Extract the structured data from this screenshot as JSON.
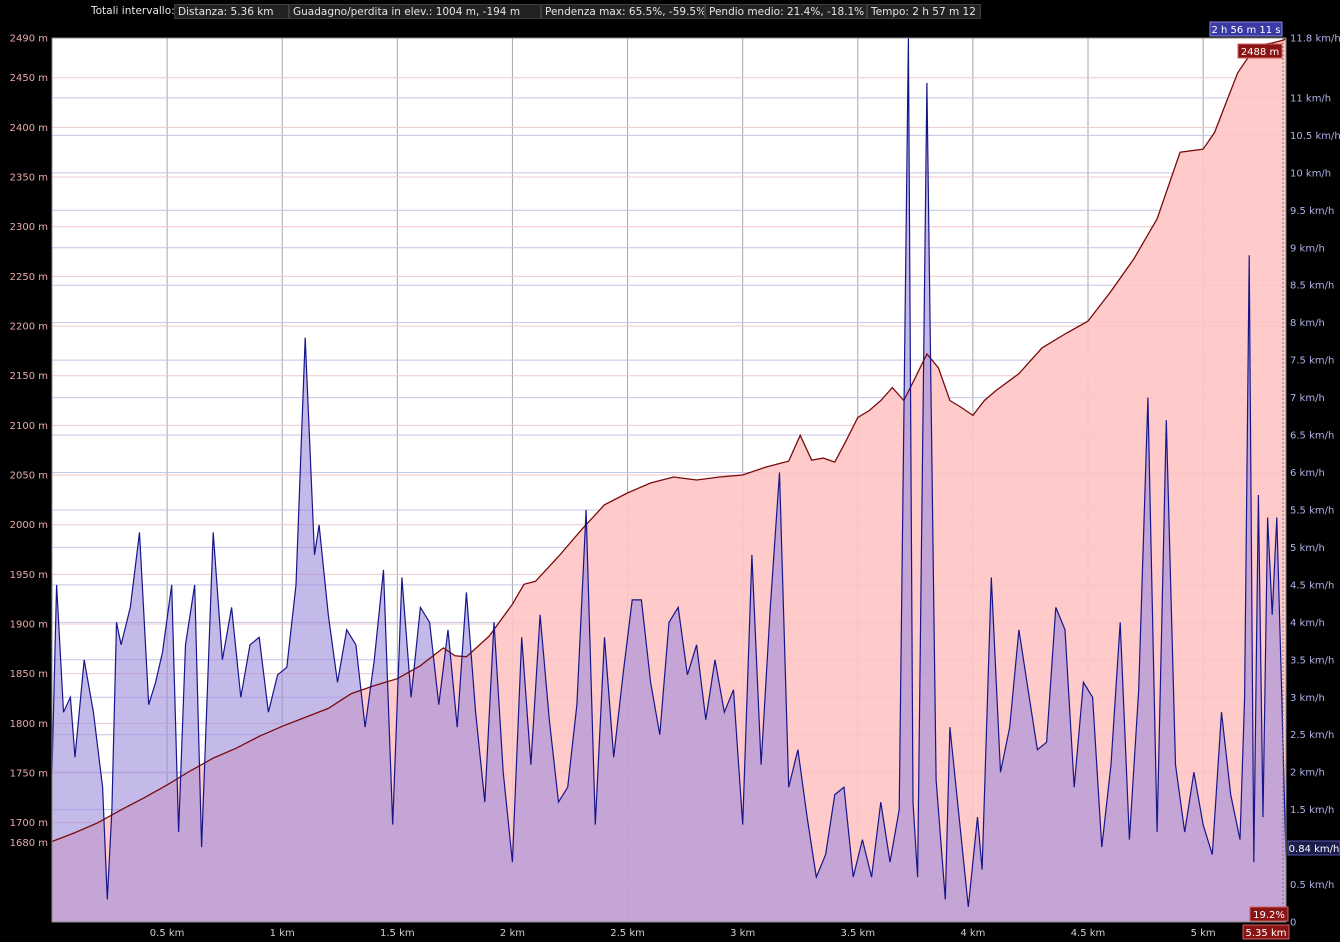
{
  "summary": {
    "label": "Totali intervallo:",
    "distance": "Distanza: 5.36 km",
    "gain_loss": "Guadagno/perdita in elev.: 1004 m, -194 m",
    "max_slope": "Pendenza max: 65.5%, -59.5%",
    "avg_slope": "Pendio medio: 21.4%, -18.1%",
    "time": "Tempo: 2 h 57 m 12 s"
  },
  "markers": {
    "time_readout": "2 h 56 m 11 s",
    "elevation_readout": "2488 m",
    "speed_readout": "0.84 km/h",
    "slope_readout": "19.2%",
    "distance_readout": "5.35 km"
  },
  "colors": {
    "elevation_line": "#7a0a0a",
    "elevation_fill": "#ffc4c4",
    "speed_line": "#16168a",
    "speed_fill": "#9c8cdc",
    "elevation_badge": "#8a1414",
    "speed_badge": "#3a3aa6"
  },
  "chart_data": {
    "type": "area",
    "x_range": [
      0,
      5.36
    ],
    "x_unit": "km",
    "x_ticks": [
      "0.5 km",
      "1 km",
      "1.5 km",
      "2 km",
      "2.5 km",
      "3 km",
      "3.5 km",
      "4 km",
      "4.5 km",
      "5 km"
    ],
    "left_axis": {
      "range": [
        1600,
        2490
      ],
      "ticks": [
        {
          "value": 2490,
          "label": "2490 m"
        },
        {
          "value": 2450,
          "label": "2450 m"
        },
        {
          "value": 2400,
          "label": "2400 m"
        },
        {
          "value": 2350,
          "label": "2350 m"
        },
        {
          "value": 2300,
          "label": "2300 m"
        },
        {
          "value": 2250,
          "label": "2250 m"
        },
        {
          "value": 2200,
          "label": "2200 m"
        },
        {
          "value": 2150,
          "label": "2150 m"
        },
        {
          "value": 2100,
          "label": "2100 m"
        },
        {
          "value": 2050,
          "label": "2050 m"
        },
        {
          "value": 2000,
          "label": "2000 m"
        },
        {
          "value": 1950,
          "label": "1950 m"
        },
        {
          "value": 1900,
          "label": "1900 m"
        },
        {
          "value": 1850,
          "label": "1850 m"
        },
        {
          "value": 1800,
          "label": "1800 m"
        },
        {
          "value": 1750,
          "label": "1750 m"
        },
        {
          "value": 1700,
          "label": "1700 m"
        },
        {
          "value": 1680,
          "label": "1680 m"
        }
      ]
    },
    "right_axis": {
      "range": [
        0,
        11.8
      ],
      "ticks": [
        {
          "value": 11.8,
          "label": "11.8 km/h"
        },
        {
          "value": 11,
          "label": "11 km/h"
        },
        {
          "value": 10.5,
          "label": "10.5 km/h"
        },
        {
          "value": 10,
          "label": "10 km/h"
        },
        {
          "value": 9.5,
          "label": "9.5 km/h"
        },
        {
          "value": 9,
          "label": "9 km/h"
        },
        {
          "value": 8.5,
          "label": "8.5 km/h"
        },
        {
          "value": 8,
          "label": "8 km/h"
        },
        {
          "value": 7.5,
          "label": "7.5 km/h"
        },
        {
          "value": 7,
          "label": "7 km/h"
        },
        {
          "value": 6.5,
          "label": "6.5 km/h"
        },
        {
          "value": 6,
          "label": "6 km/h"
        },
        {
          "value": 5.5,
          "label": "5.5 km/h"
        },
        {
          "value": 5,
          "label": "5 km/h"
        },
        {
          "value": 4.5,
          "label": "4.5 km/h"
        },
        {
          "value": 4,
          "label": "4 km/h"
        },
        {
          "value": 3.5,
          "label": "3.5 km/h"
        },
        {
          "value": 3,
          "label": "3 km/h"
        },
        {
          "value": 2.5,
          "label": "2.5 km/h"
        },
        {
          "value": 2,
          "label": "2 km/h"
        },
        {
          "value": 1.5,
          "label": "1.5 km/h"
        },
        {
          "value": 1,
          "label": "1 km/h"
        },
        {
          "value": 0.5,
          "label": "0.5 km/h"
        },
        {
          "value": 0,
          "label": "0"
        }
      ]
    },
    "series": [
      {
        "axis": "left",
        "x": [
          0,
          0.1,
          0.2,
          0.3,
          0.4,
          0.5,
          0.6,
          0.7,
          0.8,
          0.9,
          1.0,
          1.1,
          1.2,
          1.3,
          1.4,
          1.5,
          1.6,
          1.7,
          1.75,
          1.8,
          1.9,
          2.0,
          2.05,
          2.1,
          2.2,
          2.3,
          2.4,
          2.5,
          2.6,
          2.7,
          2.8,
          2.9,
          3.0,
          3.1,
          3.2,
          3.25,
          3.3,
          3.35,
          3.4,
          3.45,
          3.5,
          3.55,
          3.6,
          3.65,
          3.7,
          3.75,
          3.8,
          3.85,
          3.9,
          3.95,
          4.0,
          4.05,
          4.1,
          4.2,
          4.3,
          4.4,
          4.5,
          4.6,
          4.7,
          4.8,
          4.9,
          5.0,
          5.05,
          5.1,
          5.15,
          5.2,
          5.25,
          5.3,
          5.35,
          5.36
        ],
        "values": [
          1681,
          1690,
          1700,
          1713,
          1725,
          1738,
          1752,
          1765,
          1775,
          1787,
          1797,
          1806,
          1815,
          1830,
          1838,
          1845,
          1858,
          1876,
          1868,
          1867,
          1888,
          1920,
          1940,
          1943,
          1968,
          1995,
          2020,
          2032,
          2042,
          2048,
          2045,
          2048,
          2050,
          2058,
          2064,
          2090,
          2065,
          2067,
          2063,
          2085,
          2108,
          2115,
          2125,
          2138,
          2125,
          2148,
          2172,
          2158,
          2125,
          2118,
          2110,
          2125,
          2135,
          2152,
          2178,
          2192,
          2205,
          2235,
          2268,
          2308,
          2375,
          2378,
          2395,
          2425,
          2455,
          2472,
          2483,
          2485,
          2488,
          2490
        ]
      },
      {
        "axis": "right",
        "x": [
          0,
          0.02,
          0.05,
          0.08,
          0.1,
          0.14,
          0.18,
          0.22,
          0.24,
          0.26,
          0.28,
          0.3,
          0.34,
          0.38,
          0.42,
          0.45,
          0.48,
          0.52,
          0.55,
          0.58,
          0.62,
          0.65,
          0.7,
          0.74,
          0.78,
          0.82,
          0.86,
          0.9,
          0.94,
          0.98,
          1.02,
          1.06,
          1.1,
          1.14,
          1.16,
          1.2,
          1.24,
          1.28,
          1.32,
          1.36,
          1.4,
          1.44,
          1.48,
          1.52,
          1.56,
          1.6,
          1.64,
          1.68,
          1.72,
          1.76,
          1.8,
          1.84,
          1.88,
          1.92,
          1.96,
          2.0,
          2.04,
          2.08,
          2.12,
          2.16,
          2.2,
          2.24,
          2.28,
          2.32,
          2.36,
          2.4,
          2.44,
          2.48,
          2.52,
          2.56,
          2.6,
          2.64,
          2.68,
          2.72,
          2.76,
          2.8,
          2.84,
          2.88,
          2.92,
          2.96,
          3.0,
          3.04,
          3.08,
          3.12,
          3.16,
          3.2,
          3.24,
          3.28,
          3.32,
          3.36,
          3.4,
          3.44,
          3.48,
          3.52,
          3.56,
          3.6,
          3.64,
          3.68,
          3.72,
          3.74,
          3.76,
          3.8,
          3.84,
          3.88,
          3.9,
          3.94,
          3.98,
          4.02,
          4.04,
          4.08,
          4.12,
          4.16,
          4.2,
          4.24,
          4.28,
          4.32,
          4.36,
          4.4,
          4.44,
          4.48,
          4.52,
          4.56,
          4.6,
          4.64,
          4.68,
          4.72,
          4.76,
          4.8,
          4.84,
          4.88,
          4.92,
          4.96,
          5.0,
          5.04,
          5.08,
          5.12,
          5.16,
          5.18,
          5.2,
          5.22,
          5.24,
          5.26,
          5.28,
          5.3,
          5.32,
          5.34,
          5.36
        ],
        "values": [
          2.0,
          4.5,
          2.8,
          3.0,
          2.2,
          3.5,
          2.8,
          1.8,
          0.3,
          1.5,
          4.0,
          3.7,
          4.2,
          5.2,
          2.9,
          3.2,
          3.6,
          4.5,
          1.2,
          3.7,
          4.5,
          1.0,
          5.2,
          3.5,
          4.2,
          3.0,
          3.7,
          3.8,
          2.8,
          3.3,
          3.4,
          4.5,
          7.8,
          4.9,
          5.3,
          4.1,
          3.2,
          3.9,
          3.7,
          2.6,
          3.5,
          4.7,
          1.3,
          4.6,
          3.0,
          4.2,
          4.0,
          2.9,
          3.9,
          2.6,
          4.4,
          2.8,
          1.6,
          4.0,
          2.0,
          0.8,
          3.8,
          2.1,
          4.1,
          2.7,
          1.6,
          1.8,
          2.9,
          5.5,
          1.3,
          3.8,
          2.2,
          3.3,
          4.3,
          4.3,
          3.2,
          2.5,
          4.0,
          4.2,
          3.3,
          3.7,
          2.7,
          3.5,
          2.8,
          3.1,
          1.3,
          4.9,
          2.1,
          4.2,
          6.0,
          1.8,
          2.3,
          1.4,
          0.6,
          0.9,
          1.7,
          1.8,
          0.6,
          1.1,
          0.6,
          1.6,
          0.8,
          1.5,
          11.8,
          1.6,
          0.6,
          11.2,
          1.9,
          0.3,
          2.6,
          1.4,
          0.2,
          1.4,
          0.7,
          4.6,
          2.0,
          2.6,
          3.9,
          3.1,
          2.3,
          2.4,
          4.2,
          3.9,
          1.8,
          3.2,
          3.0,
          1.0,
          2.1,
          4.0,
          1.1,
          3.1,
          7.0,
          1.2,
          6.7,
          2.1,
          1.2,
          2.0,
          1.3,
          0.9,
          2.8,
          1.7,
          1.1,
          3.0,
          8.9,
          0.8,
          5.7,
          1.4,
          5.4,
          4.1,
          5.4,
          3.2,
          0.84
        ]
      }
    ]
  }
}
